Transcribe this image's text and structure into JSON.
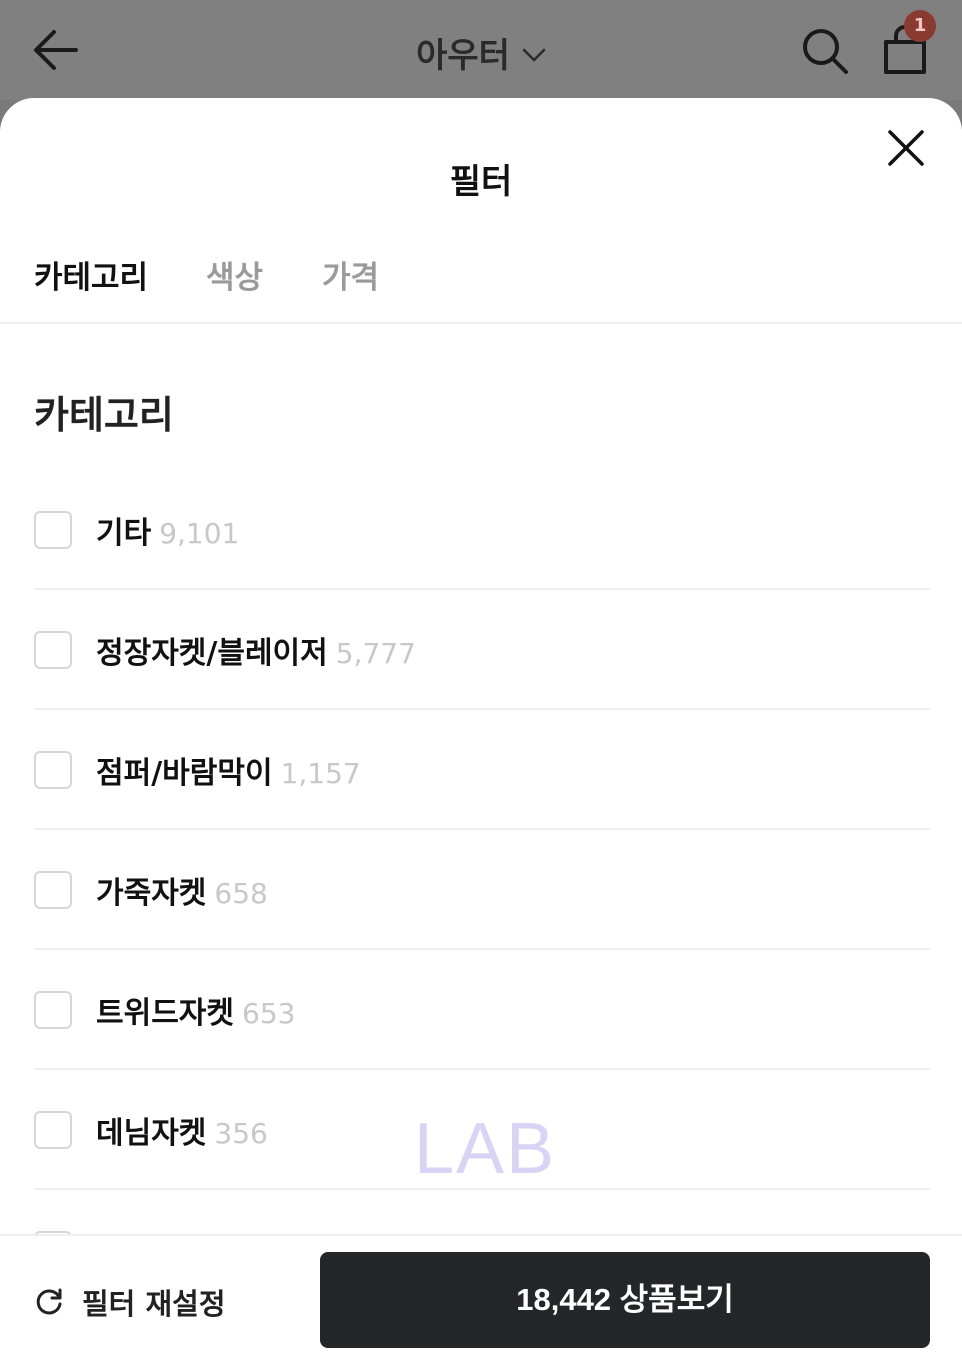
{
  "appbar": {
    "title": "아우터",
    "cart_badge": "1",
    "icons": [
      "back-arrow-icon",
      "chevron-down-icon",
      "search-icon",
      "shopping-bag-icon"
    ]
  },
  "sheet": {
    "title": "필터",
    "close_icon": "close-icon",
    "tabs": [
      {
        "label": "카테고리",
        "active": true
      },
      {
        "label": "색상",
        "active": false
      },
      {
        "label": "가격",
        "active": false
      }
    ],
    "section_title": "카테고리",
    "categories": [
      {
        "name": "기타",
        "count": "9,101",
        "checked": false
      },
      {
        "name": "정장자켓/블레이저",
        "count": "5,777",
        "checked": false
      },
      {
        "name": "점퍼/바람막이",
        "count": "1,157",
        "checked": false
      },
      {
        "name": "가죽자켓",
        "count": "658",
        "checked": false
      },
      {
        "name": "트위드자켓",
        "count": "653",
        "checked": false
      },
      {
        "name": "데님자켓",
        "count": "356",
        "checked": false
      }
    ],
    "watermark": "LAB"
  },
  "footer": {
    "reset_label": "필터 재설정",
    "reset_icon": "refresh-icon",
    "cta_label": "18,442 상품보기"
  },
  "colors": {
    "cta_bg": "#25262a",
    "badge_bg": "#8b3a32",
    "count_text": "#c8c8c8",
    "inactive_tab": "#9a9a9a"
  }
}
